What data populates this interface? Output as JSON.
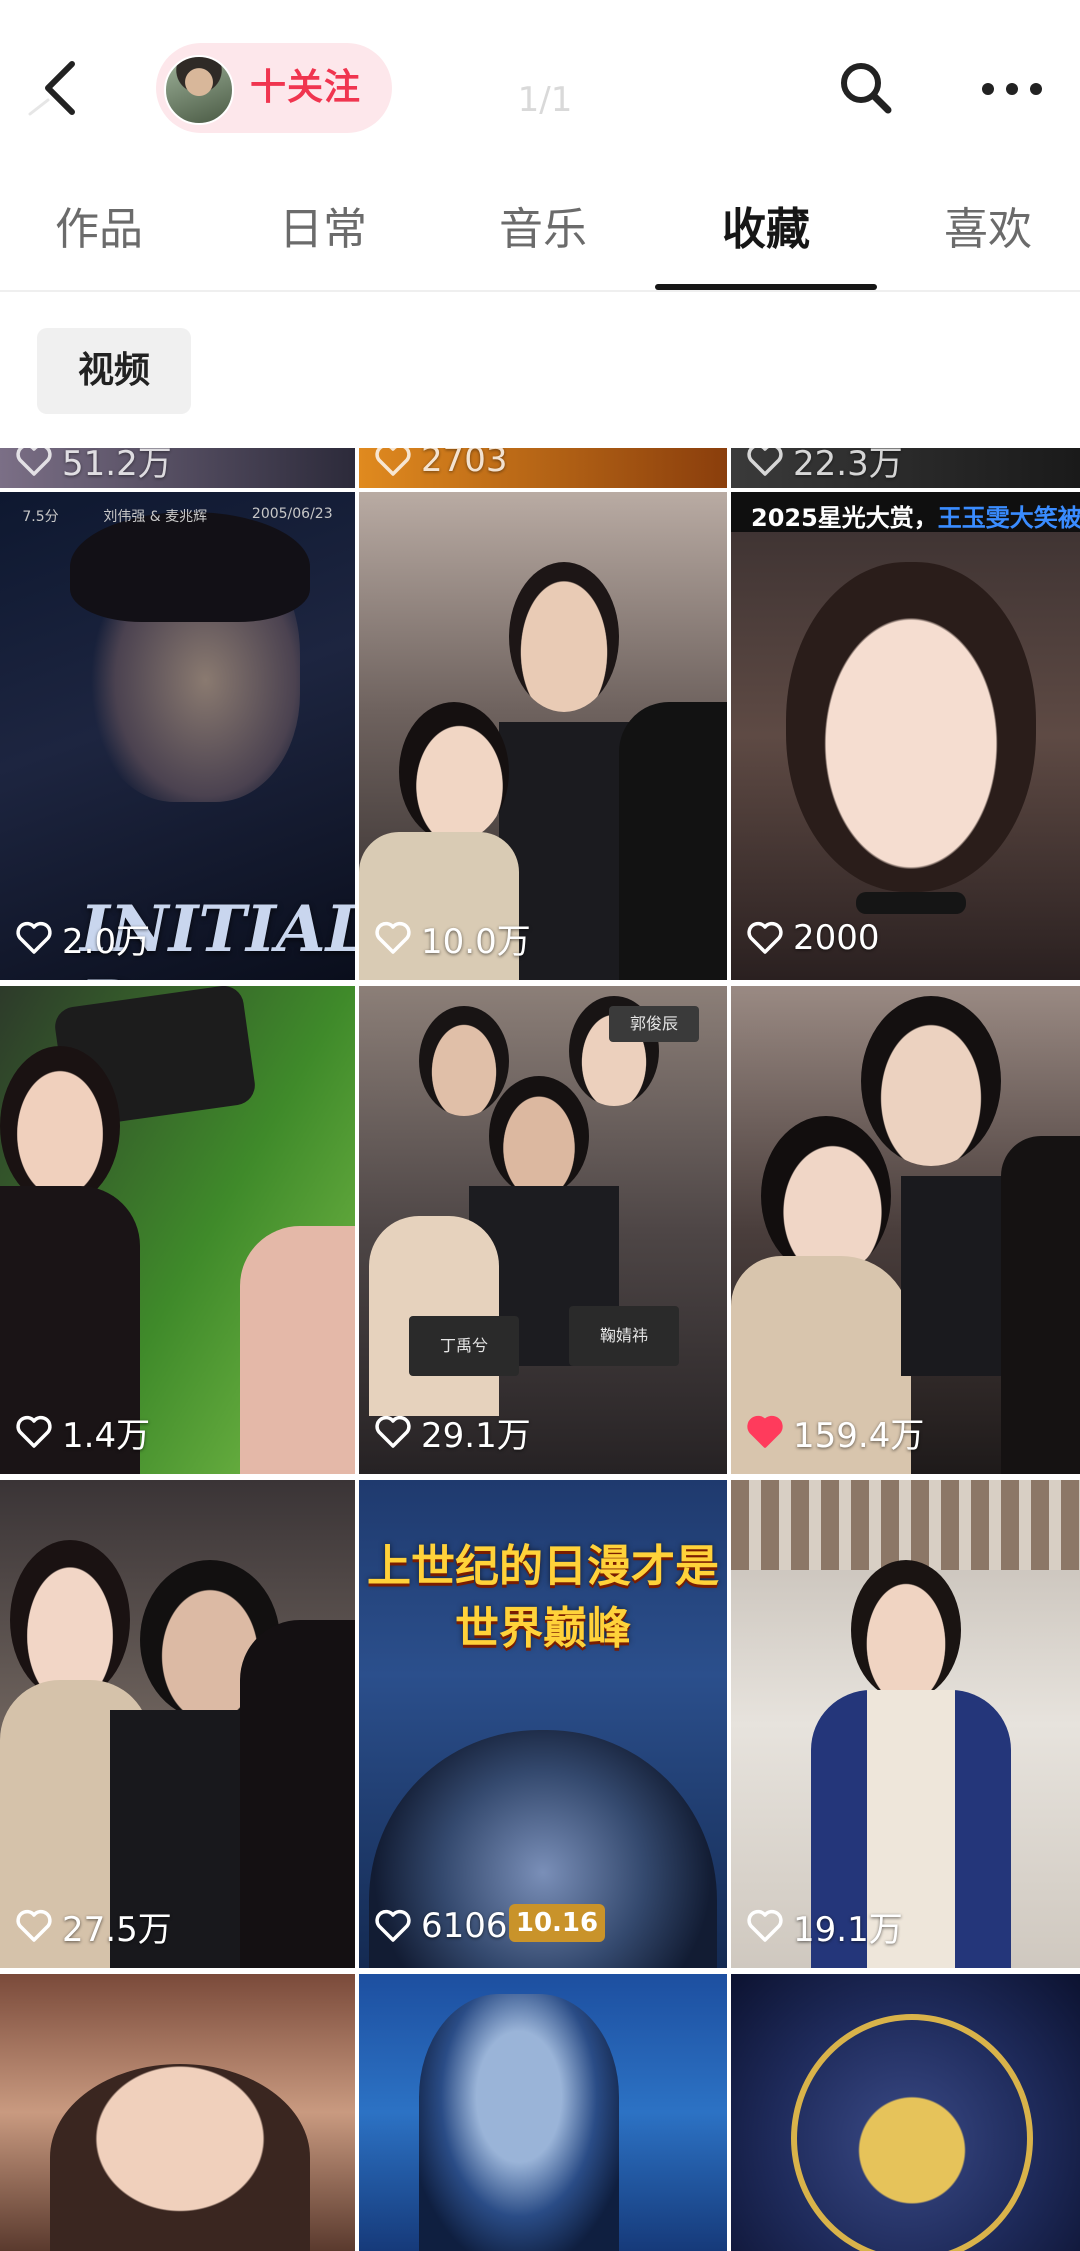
{
  "header": {
    "follow_label": "十关注",
    "page_indicator": "1/1",
    "back_icon": "chevron-left-icon",
    "search_icon": "search-icon",
    "more_icon": "more-dots-icon"
  },
  "tabs": [
    {
      "label": "作品",
      "active": false
    },
    {
      "label": "日常",
      "active": false
    },
    {
      "label": "音乐",
      "active": false
    },
    {
      "label": "收藏",
      "active": true
    },
    {
      "label": "喜欢",
      "active": false
    }
  ],
  "filter": {
    "label": "视频"
  },
  "colors": {
    "accent": "#f0354f",
    "follow_bg": "#fde7eb",
    "liked_heart": "#ff3b5c"
  },
  "grid": {
    "partial_row_likes": [
      "51.2万",
      "2703",
      "22.3万"
    ],
    "items": [
      {
        "likes": "2.0万",
        "liked": false,
        "logo": "INITIAL D",
        "credits": [
          "7.5分",
          "刘伟强 & 麦兆辉",
          "2005/06/23"
        ]
      },
      {
        "likes": "10.0万",
        "liked": false
      },
      {
        "likes": "2000",
        "liked": false,
        "banner_prefix": "2025星光大赏，",
        "banner_highlight": "王玉雯大笑被抓包"
      },
      {
        "likes": "1.4万",
        "liked": false
      },
      {
        "likes": "29.1万",
        "liked": false,
        "seat_signs": [
          "丁禹兮",
          "鞠婧祎",
          "郭俊辰"
        ]
      },
      {
        "likes": "159.4万",
        "liked": true
      },
      {
        "likes": "27.5万",
        "liked": false
      },
      {
        "likes": "6106",
        "liked": false,
        "poster_line1": "上世纪的日漫才是",
        "poster_line2": "世界巅峰",
        "badge": "10.16"
      },
      {
        "likes": "19.1万",
        "liked": false
      },
      {},
      {},
      {}
    ]
  }
}
